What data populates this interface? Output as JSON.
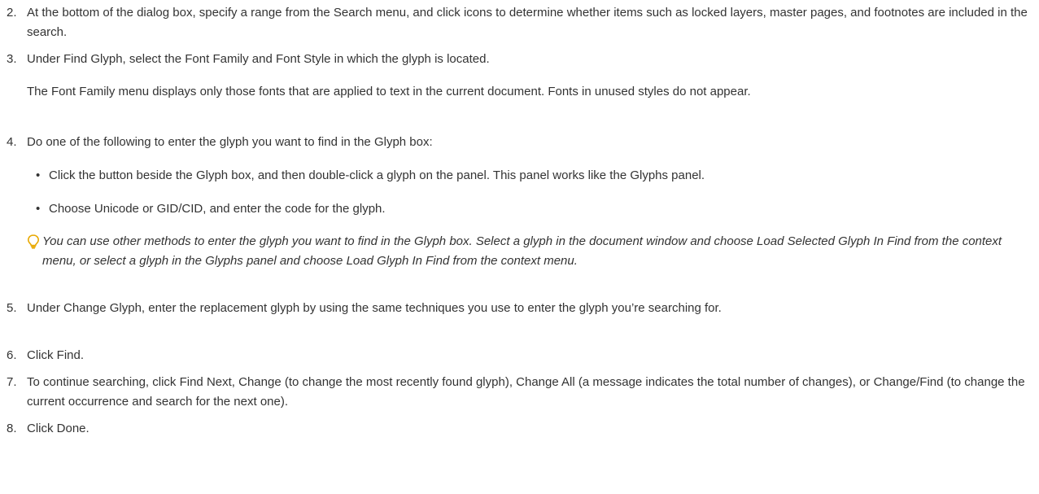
{
  "steps": [
    {
      "num": "2.",
      "text": "At the bottom of the dialog box, specify a range from the Search menu, and click icons to determine whether items such as locked layers, master pages, and footnotes are included in the search."
    },
    {
      "num": "3.",
      "text": "Under Find Glyph, select the Font Family and Font Style in which the glyph is located."
    },
    {
      "num": "4.",
      "text": "Do one of the following to enter the glyph you want to find in the Glyph box:"
    },
    {
      "num": "5.",
      "text": "Under Change Glyph, enter the replacement glyph by using the same techniques you use to enter the glyph you’re searching for."
    },
    {
      "num": "6.",
      "text": "Click Find."
    },
    {
      "num": "7.",
      "text": "To continue searching, click Find Next, Change (to change the most recently found glyph), Change All (a message indicates the total number of changes), or Change/Find (to change the current occurrence and search for the next one)."
    },
    {
      "num": "8.",
      "text": "Click Done."
    }
  ],
  "step3_note": "The Font Family menu displays only those fonts that are applied to text in the current document. Fonts in unused styles do not appear.",
  "step4_bullets": [
    "Click the button beside the Glyph box, and then double-click a glyph on the panel. This panel works like the Glyphs panel.",
    "Choose Unicode or GID/CID, and enter the code for the glyph."
  ],
  "bullet_glyph": "•",
  "tip": {
    "icon": "lightbulb-icon",
    "icon_color": "#e8a800",
    "text": "You can use other methods to enter the glyph you want to find in the Glyph box. Select a glyph in the document window and choose Load Selected Glyph In Find from the context menu, or select a glyph in the Glyphs panel and choose Load Glyph In Find from the context menu."
  }
}
